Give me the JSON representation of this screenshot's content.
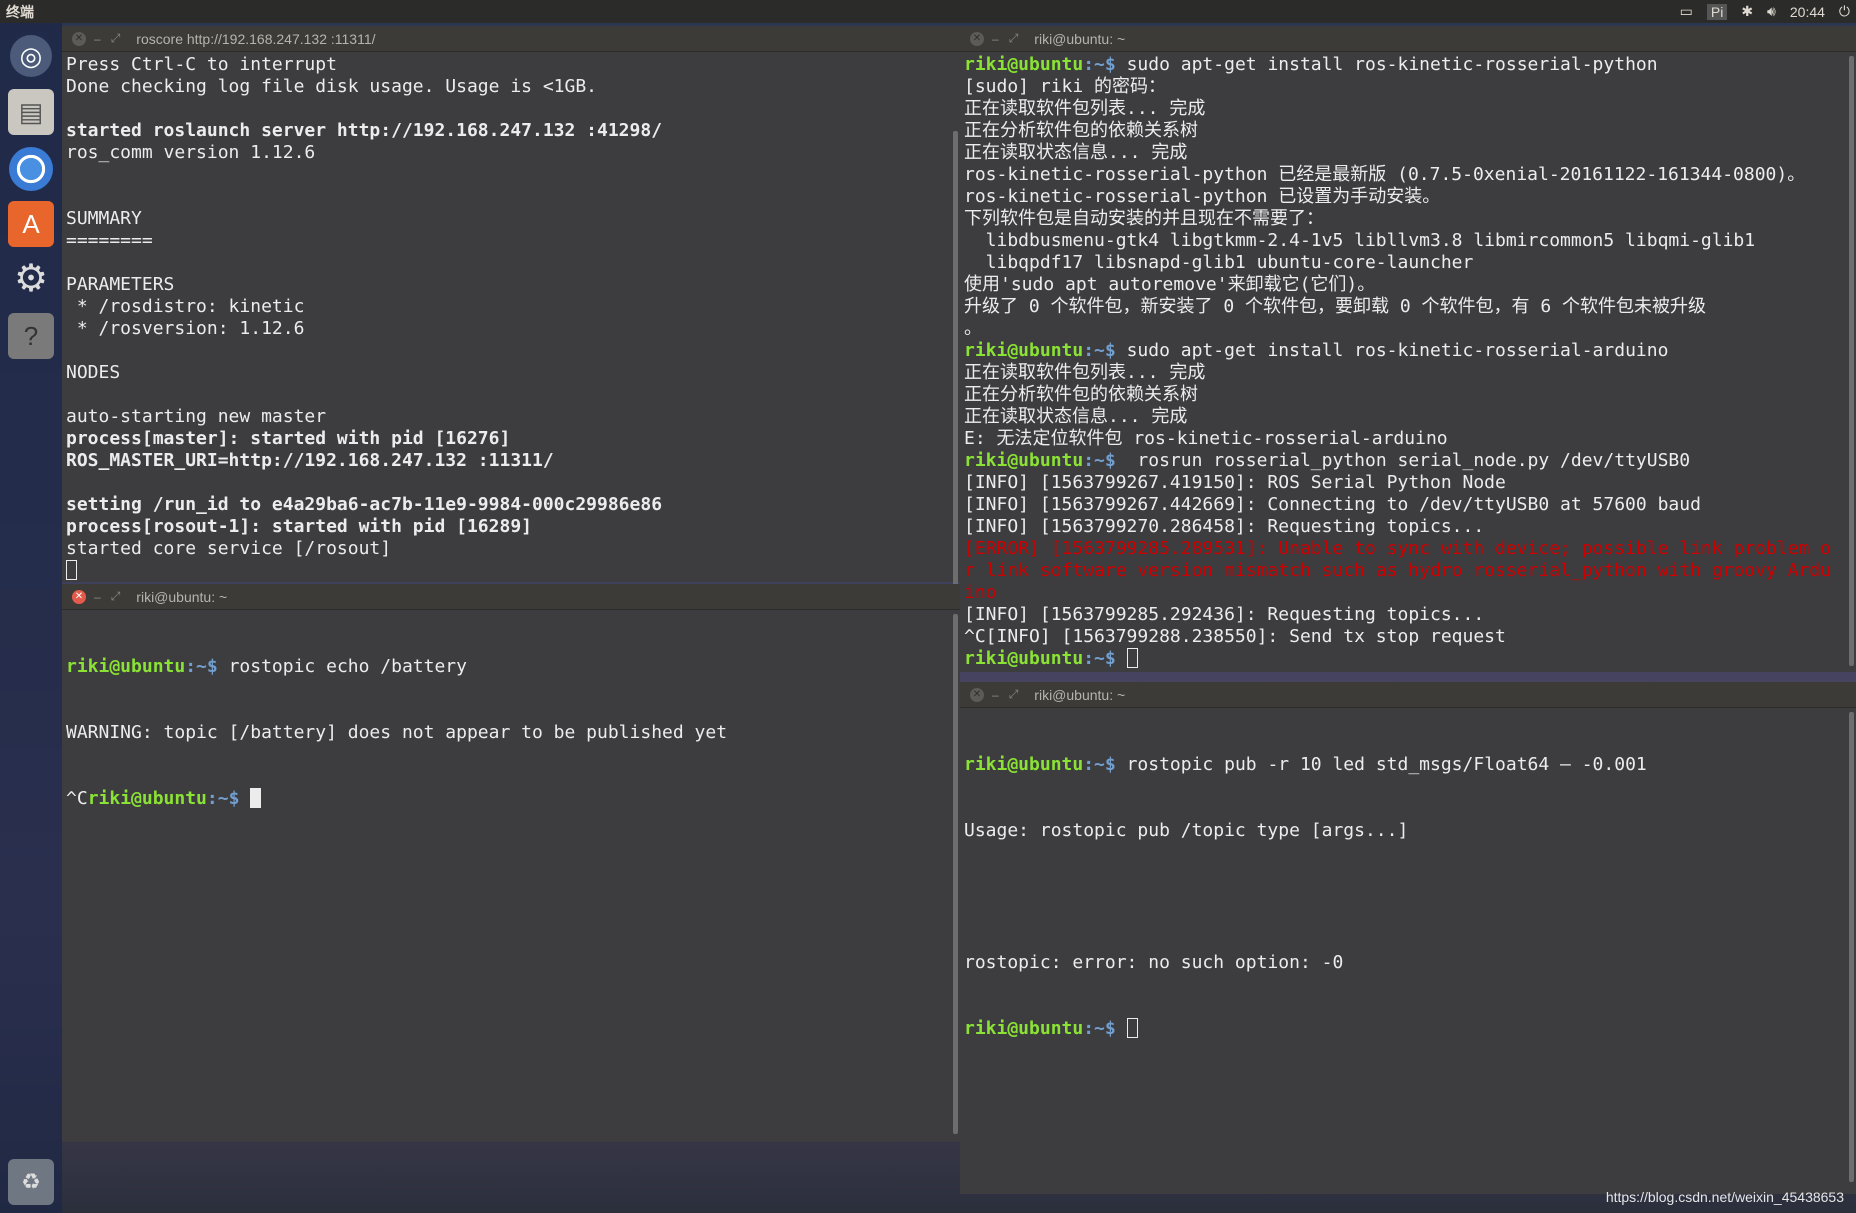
{
  "topbar": {
    "app_title": "终端",
    "pi_label": "Pi",
    "time": "20:44"
  },
  "launcher": {
    "icons": [
      "ubuntu-dash-icon",
      "files-icon",
      "chromium-icon",
      "software-center-icon",
      "settings-icon",
      "help-icon",
      "trash-icon"
    ]
  },
  "term1": {
    "title": "roscore http://192.168.247.132 :11311/",
    "lines": [
      {
        "t": "Press Ctrl-C to interrupt",
        "s": ""
      },
      {
        "t": "Done checking log file disk usage. Usage is <1GB.",
        "s": ""
      },
      {
        "t": "",
        "s": ""
      },
      {
        "t": "started roslaunch server http://192.168.247.132 :41298/",
        "s": "b"
      },
      {
        "t": "ros_comm version 1.12.6",
        "s": ""
      },
      {
        "t": "",
        "s": ""
      },
      {
        "t": "",
        "s": ""
      },
      {
        "t": "SUMMARY",
        "s": ""
      },
      {
        "t": "========",
        "s": ""
      },
      {
        "t": "",
        "s": ""
      },
      {
        "t": "PARAMETERS",
        "s": ""
      },
      {
        "t": " * /rosdistro: kinetic",
        "s": ""
      },
      {
        "t": " * /rosversion: 1.12.6",
        "s": ""
      },
      {
        "t": "",
        "s": ""
      },
      {
        "t": "NODES",
        "s": ""
      },
      {
        "t": "",
        "s": ""
      },
      {
        "t": "auto-starting new master",
        "s": ""
      },
      {
        "t": "process[master]: started with pid [16276]",
        "s": "b"
      },
      {
        "t": "ROS_MASTER_URI=http://192.168.247.132 :11311/",
        "s": "b"
      },
      {
        "t": "",
        "s": ""
      },
      {
        "t": "setting /run_id to e4a29ba6-ac7b-11e9-9984-000c29986e86",
        "s": "b"
      },
      {
        "t": "process[rosout-1]: started with pid [16289]",
        "s": "b"
      },
      {
        "t": "started core service [/rosout]",
        "s": ""
      }
    ]
  },
  "term2": {
    "title": "riki@ubuntu: ~",
    "prompt_user": "riki@ubuntu",
    "prompt_path": ":~$",
    "cmd1": " rostopic echo /battery",
    "warning": "WARNING: topic [/battery] does not appear to be published yet",
    "ctrl_c": "^C"
  },
  "term3": {
    "title": "riki@ubuntu: ~",
    "prompt_user": "riki@ubuntu",
    "prompt_path": ":~$",
    "blocks": [
      {
        "type": "cmd",
        "t": " sudo apt-get install ros-kinetic-rosserial-python"
      },
      {
        "type": "out",
        "t": "[sudo] riki 的密码："
      },
      {
        "type": "out",
        "t": "正在读取软件包列表... 完成"
      },
      {
        "type": "out",
        "t": "正在分析软件包的依赖关系树"
      },
      {
        "type": "out",
        "t": "正在读取状态信息... 完成"
      },
      {
        "type": "out",
        "t": "ros-kinetic-rosserial-python 已经是最新版 (0.7.5-0xenial-20161122-161344-0800)。"
      },
      {
        "type": "out",
        "t": "ros-kinetic-rosserial-python 已设置为手动安装。"
      },
      {
        "type": "out",
        "t": "下列软件包是自动安装的并且现在不需要了："
      },
      {
        "type": "out",
        "t": "  libdbusmenu-gtk4 libgtkmm-2.4-1v5 libllvm3.8 libmircommon5 libqmi-glib1"
      },
      {
        "type": "out",
        "t": "  libqpdf17 libsnapd-glib1 ubuntu-core-launcher"
      },
      {
        "type": "out",
        "t": "使用'sudo apt autoremove'来卸载它(它们)。"
      },
      {
        "type": "out",
        "t": "升级了 0 个软件包，新安装了 0 个软件包，要卸载 0 个软件包，有 6 个软件包未被升级"
      },
      {
        "type": "out",
        "t": "。"
      },
      {
        "type": "cmd",
        "t": " sudo apt-get install ros-kinetic-rosserial-arduino"
      },
      {
        "type": "out",
        "t": "正在读取软件包列表... 完成"
      },
      {
        "type": "out",
        "t": "正在分析软件包的依赖关系树"
      },
      {
        "type": "out",
        "t": "正在读取状态信息... 完成"
      },
      {
        "type": "out",
        "t": "E: 无法定位软件包 ros-kinetic-rosserial-arduino"
      },
      {
        "type": "cmd",
        "t": "  rosrun rosserial_python serial_node.py /dev/ttyUSB0"
      },
      {
        "type": "out",
        "t": "[INFO] [1563799267.419150]: ROS Serial Python Node"
      },
      {
        "type": "out",
        "t": "[INFO] [1563799267.442669]: Connecting to /dev/ttyUSB0 at 57600 baud"
      },
      {
        "type": "out",
        "t": "[INFO] [1563799270.286458]: Requesting topics..."
      },
      {
        "type": "err",
        "t": "[ERROR] [1563799285.289531]: Unable to sync with device; possible link problem o"
      },
      {
        "type": "err",
        "t": "r link software version mismatch such as hydro rosserial_python with groovy Ardu"
      },
      {
        "type": "err",
        "t": "ino"
      },
      {
        "type": "out",
        "t": "[INFO] [1563799285.292436]: Requesting topics..."
      },
      {
        "type": "out",
        "t": "^C[INFO] [1563799288.238550]: Send tx stop request"
      }
    ]
  },
  "term4": {
    "title": "riki@ubuntu: ~",
    "prompt_user": "riki@ubuntu",
    "prompt_path": ":~$",
    "cmd": " rostopic pub -r 10 led std_msgs/Float64 — -0.001",
    "out1": "Usage: rostopic pub /topic type [args...]",
    "out2": "rostopic: error: no such option: -0"
  },
  "watermark": "https://blog.csdn.net/weixin_45438653"
}
